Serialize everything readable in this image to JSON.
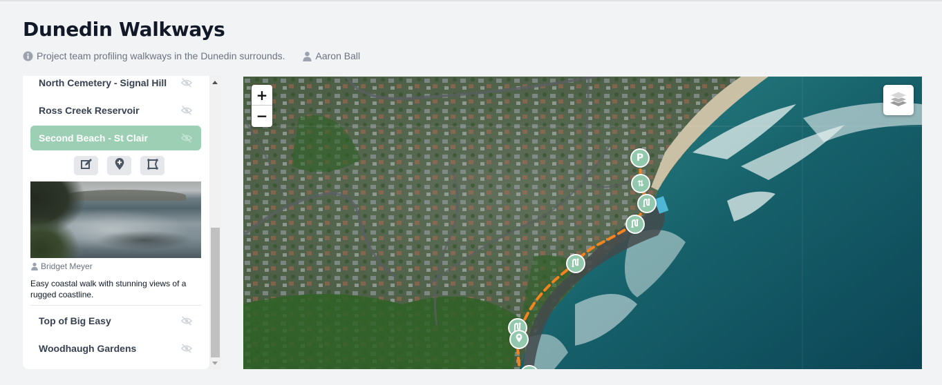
{
  "header": {
    "title": "Dunedin Walkways",
    "description": "Project team profiling walkways in the Dunedin surrounds.",
    "owner": "Aaron Ball"
  },
  "sidebar": {
    "walks": [
      {
        "label": "North Cemetery - Signal Hill",
        "visible": false,
        "selected": false
      },
      {
        "label": "Ross Creek Reservoir",
        "visible": false,
        "selected": false
      },
      {
        "label": "Second Beach - St Clair",
        "visible": false,
        "selected": true
      },
      {
        "label": "Top of Big Easy",
        "visible": false,
        "selected": false
      },
      {
        "label": "Woodhaugh Gardens",
        "visible": false,
        "selected": false
      }
    ],
    "selected_detail": {
      "tools": [
        {
          "name": "edit",
          "icon": "edit-icon"
        },
        {
          "name": "add-point",
          "icon": "add-marker-icon"
        },
        {
          "name": "edit-shape",
          "icon": "polygon-icon"
        }
      ],
      "photo_alt": "Coastal view with rocks and sea",
      "author": "Bridget Meyer",
      "description": "Easy coastal walk with stunning views of a rugged coastline."
    }
  },
  "map": {
    "zoom_in_label": "+",
    "zoom_out_label": "−",
    "layers_icon": "layers-icon",
    "route_color": "#f5841f",
    "marker_color": "#92c9ad",
    "markers": [
      {
        "type": "parking",
        "label": "P"
      },
      {
        "type": "steps",
        "label": "⇅"
      },
      {
        "type": "track"
      },
      {
        "type": "track"
      },
      {
        "type": "track"
      },
      {
        "type": "track"
      },
      {
        "type": "point-of-interest"
      }
    ]
  },
  "colors": {
    "accent": "#9dcfb4",
    "background": "#f2f3f5"
  }
}
